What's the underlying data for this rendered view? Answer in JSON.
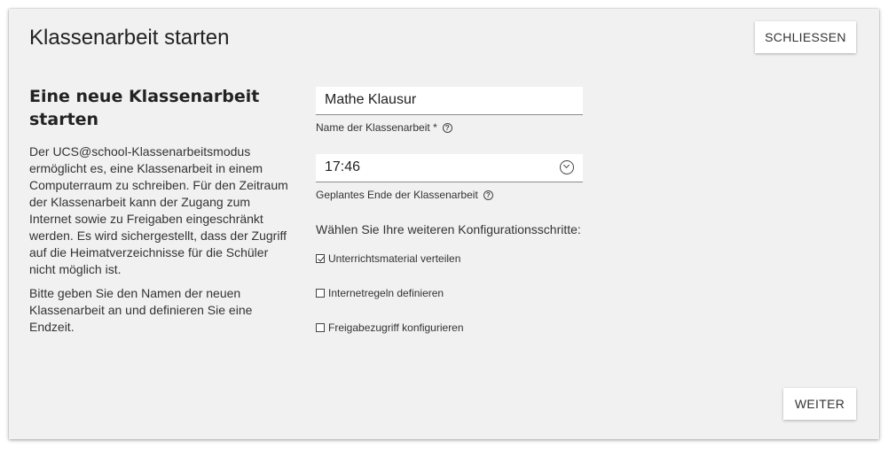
{
  "dialog": {
    "title": "Klassenarbeit starten",
    "close_label": "SCHLIESSEN",
    "next_label": "WEITER"
  },
  "intro": {
    "heading": "Eine neue Klassenarbeit starten",
    "paragraph_1": "Der UCS@school-Klassenarbeitsmodus ermöglicht es, eine Klassenarbeit in einem Computerraum zu schreiben. Für den Zeitraum der Klassenarbeit kann der Zugang zum Internet sowie zu Freigaben eingeschränkt werden. Es wird sichergestellt, dass der Zugriff auf die Heimatverzeichnisse für die Schüler nicht möglich ist.",
    "paragraph_2": "Bitte geben Sie den Namen der neuen Klassenarbeit an und definieren Sie eine Endzeit."
  },
  "form": {
    "name": {
      "value": "Mathe Klausur",
      "label": "Name der Klassenarbeit *",
      "help_icon": "question-circle-icon"
    },
    "end_time": {
      "value": "17:46",
      "label": "Geplantes Ende der Klassenarbeit",
      "help_icon": "question-circle-icon",
      "picker_icon": "chevron-down-circle-icon"
    },
    "config_title": "Wählen Sie Ihre weiteren Konfigurationsschritte:",
    "options": [
      {
        "label": "Unterrichtsmaterial verteilen",
        "checked": true
      },
      {
        "label": "Internetregeln definieren",
        "checked": false
      },
      {
        "label": "Freigabezugriff konfigurieren",
        "checked": false
      }
    ]
  },
  "colors": {
    "dialog_background": "#f1f1f1",
    "field_background": "#ffffff",
    "text": "#333333"
  }
}
